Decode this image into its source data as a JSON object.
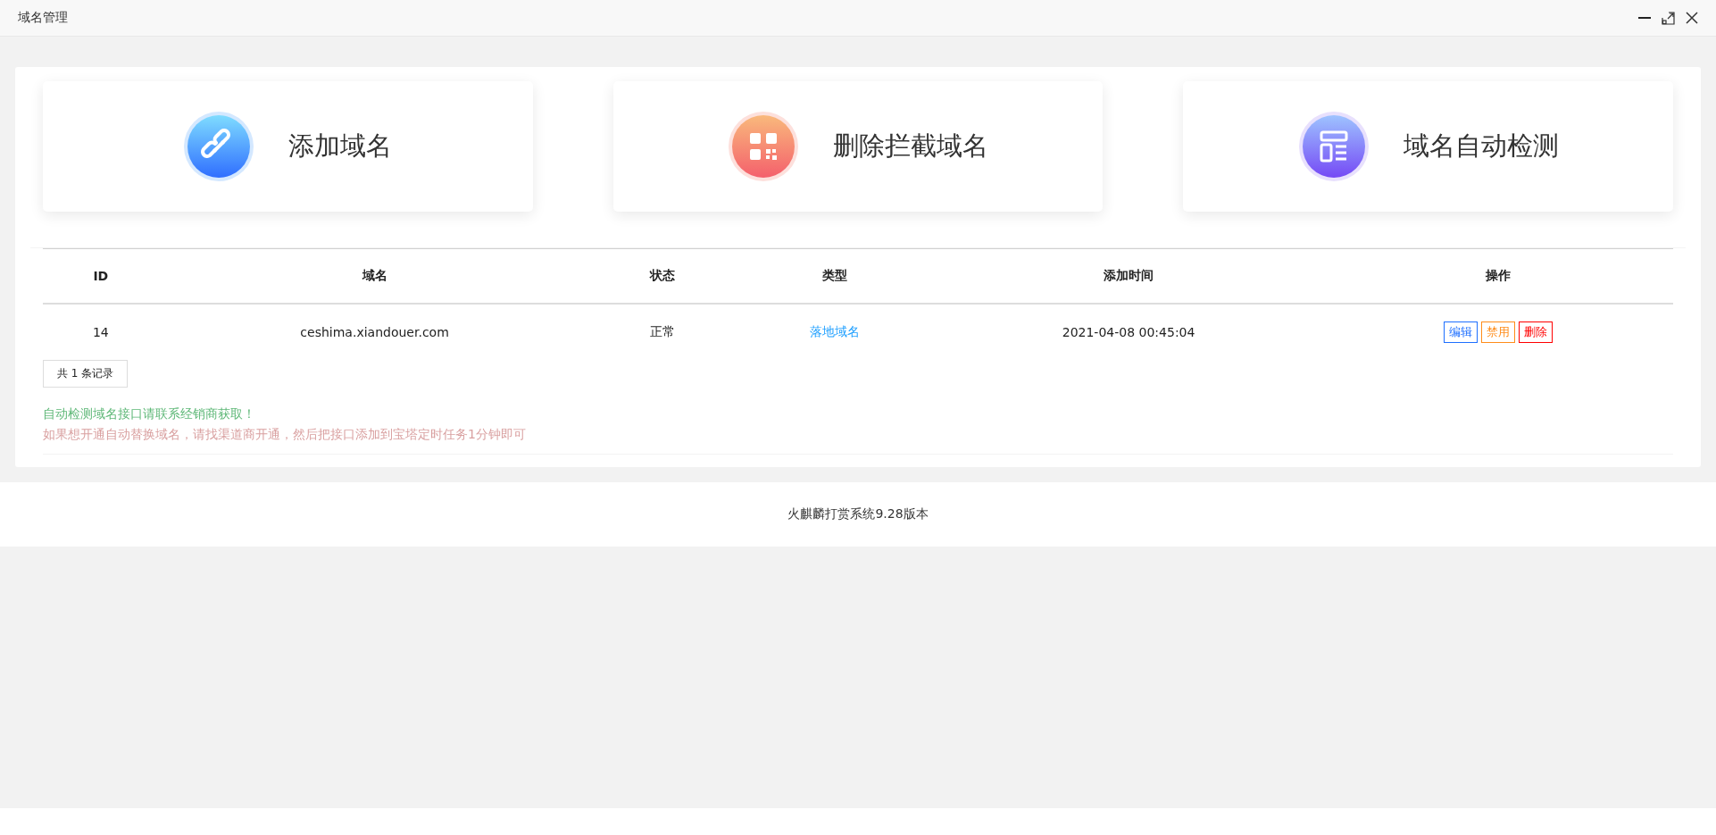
{
  "window": {
    "title": "域名管理"
  },
  "cards": [
    {
      "kind": "link",
      "label": "添加域名"
    },
    {
      "kind": "qrcode",
      "label": "删除拦截域名"
    },
    {
      "kind": "layout",
      "label": "域名自动检测"
    }
  ],
  "table": {
    "columns": [
      "ID",
      "域名",
      "状态",
      "类型",
      "添加时间",
      "操作"
    ],
    "rows": [
      {
        "id": "14",
        "domain": "ceshima.xiandouer.com",
        "status": "正常",
        "type": "落地域名",
        "added": "2021-04-08 00:45:04",
        "actions": [
          {
            "kind": "edit",
            "label": "编辑"
          },
          {
            "kind": "disable",
            "label": "禁用"
          },
          {
            "kind": "delete",
            "label": "删除"
          }
        ]
      }
    ]
  },
  "record_count": "共 1 条记录",
  "notes": [
    {
      "kind": "success",
      "text": "自动检测域名接口请联系经销商获取！"
    },
    {
      "kind": "hint",
      "text": "如果想开通自动替换域名，请找渠道商开通，然后把接口添加到宝塔定时任务1分钟即可"
    }
  ],
  "footer": "火麒麟打赏系统9.28版本"
}
